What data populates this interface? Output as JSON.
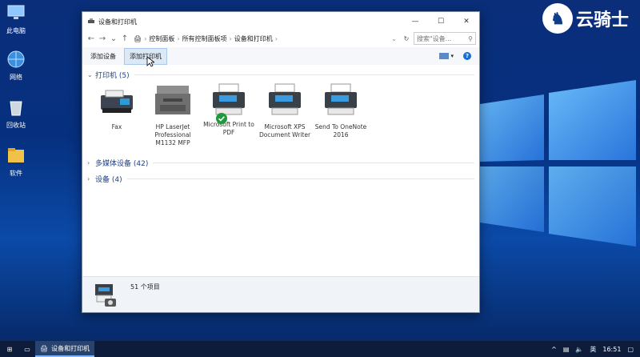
{
  "desktop": {
    "icons": [
      {
        "label": "此电脑",
        "icon": "this-pc-icon"
      },
      {
        "label": "网络",
        "icon": "network-icon"
      },
      {
        "label": "回收站",
        "icon": "recycle-bin-icon"
      },
      {
        "label": "软件",
        "icon": "folder-icon"
      }
    ],
    "brand_text": "云骑士"
  },
  "window": {
    "title": "设备和打印机",
    "breadcrumb": [
      "控制面板",
      "所有控制面板项",
      "设备和打印机"
    ],
    "search_placeholder": "搜索\"设备...",
    "toolbar": {
      "add_device": "添加设备",
      "add_printer": "添加打印机",
      "help": "?"
    },
    "sections": {
      "printers": "打印机 (5)",
      "multimedia": "多媒体设备 (42)",
      "devices": "设备 (4)"
    },
    "printers": [
      {
        "label": "Fax",
        "icon": "fax-icon"
      },
      {
        "label": "HP LaserJet Professional M1132 MFP",
        "icon": "mfp-printer-icon"
      },
      {
        "label": "Microsoft Print to PDF",
        "icon": "printer-icon",
        "default": true
      },
      {
        "label": "Microsoft XPS Document Writer",
        "icon": "printer-icon"
      },
      {
        "label": "Send To OneNote 2016",
        "icon": "printer-icon"
      }
    ],
    "status_text": "51 个项目"
  },
  "taskbar": {
    "task_label": "设备和打印机",
    "ime": "英",
    "time": "16:51"
  },
  "colors": {
    "accent": "#1b6ed1",
    "desktop": "#0a2e7a",
    "section_text": "#1e3f8a"
  }
}
